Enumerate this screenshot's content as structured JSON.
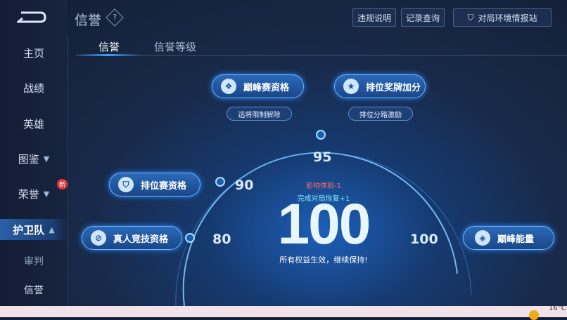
{
  "header": {
    "title": "信誉",
    "help_icon": "?",
    "buttons": [
      "违规说明",
      "记录查询",
      "对局环境情报站"
    ]
  },
  "sidebar": {
    "items": [
      {
        "label": "主页"
      },
      {
        "label": "战绩"
      },
      {
        "label": "英雄"
      },
      {
        "label": "图鉴",
        "chevron": "down"
      },
      {
        "label": "荣誉",
        "chevron": "down",
        "badge": "新"
      },
      {
        "label": "护卫队",
        "chevron": "up",
        "active": true
      },
      {
        "label": "审判"
      },
      {
        "label": "信誉"
      }
    ]
  },
  "tabs": [
    {
      "label": "信誉",
      "active": true
    },
    {
      "label": "信誉等级"
    }
  ],
  "privileges": {
    "peak_qualification": "巅峰赛资格",
    "ranked_bonus": "排位奖牌加分",
    "peak_sub": "选将限制解除",
    "ranked_sub": "排位分路激励",
    "ranked_qualification": "排位赛资格",
    "real_competitive": "真人竞技资格",
    "peak_energy": "巅峰能量"
  },
  "gauge": {
    "marks": [
      "95",
      "90",
      "80",
      "100"
    ],
    "score": "100",
    "penalty": "影响体验-1",
    "recovery": "完成对局恢复+1",
    "message": "所有权益生效，继续保持!"
  },
  "taskbar": {
    "weather": "16°C"
  },
  "colors": {
    "accent": "#3aa0ff",
    "penalty": "#ff6a6a",
    "recovery": "#7fe8ff"
  }
}
